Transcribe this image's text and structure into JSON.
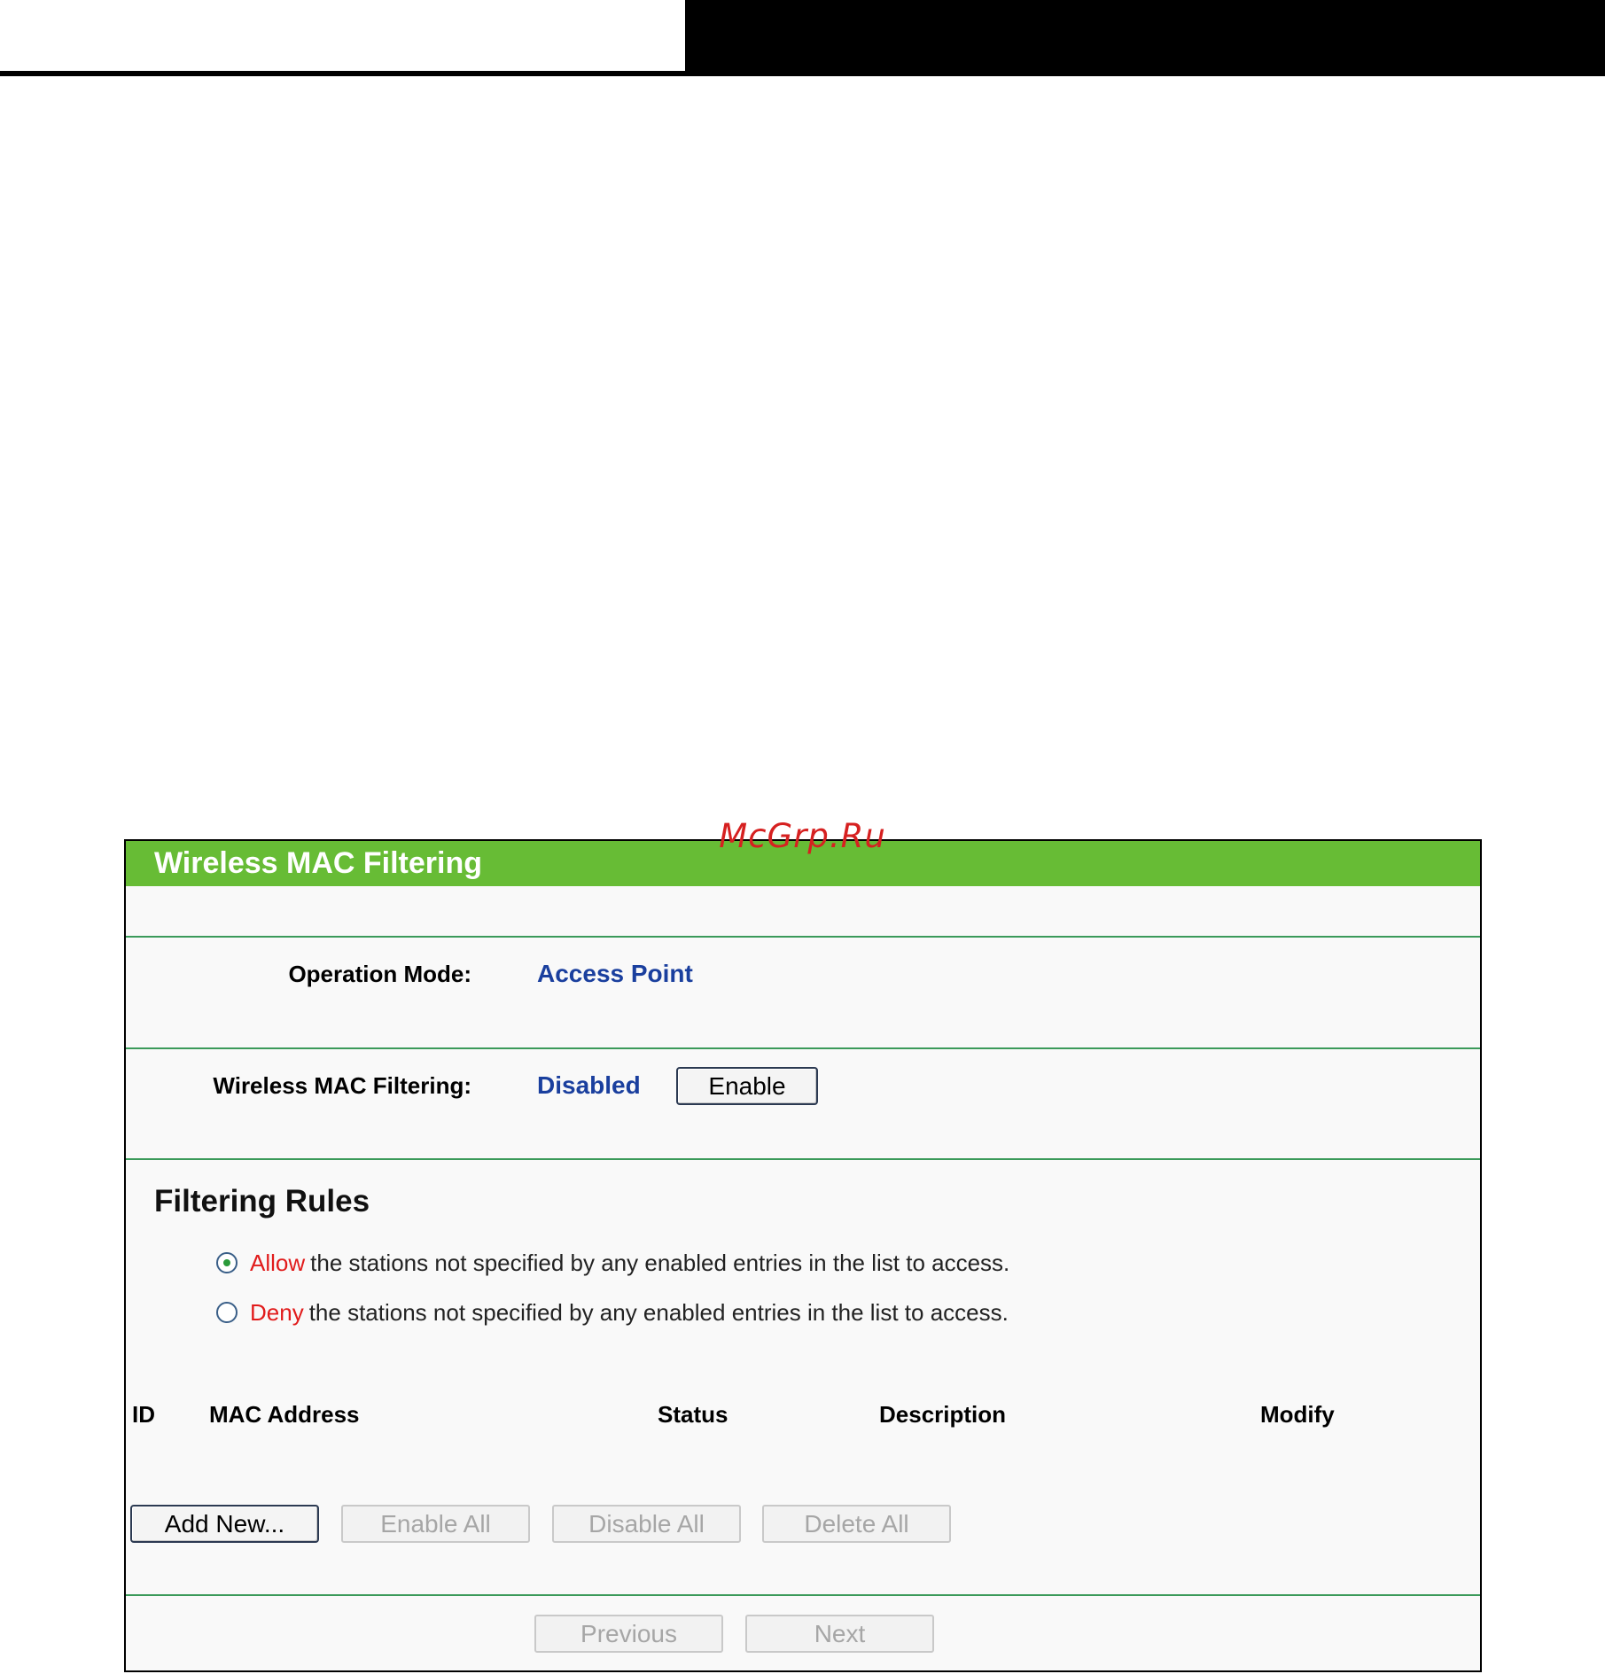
{
  "watermark": "McGrp.Ru",
  "panel": {
    "title": "Wireless MAC Filtering"
  },
  "operation_mode": {
    "label": "Operation Mode:",
    "value": "Access Point"
  },
  "mac_filtering": {
    "label": "Wireless MAC Filtering:",
    "status": "Disabled",
    "enable_button": "Enable"
  },
  "filtering_rules": {
    "heading": "Filtering Rules",
    "options": [
      {
        "keyword": "Allow",
        "text": "the stations not specified by any enabled entries in the list to access.",
        "checked": true
      },
      {
        "keyword": "Deny",
        "text": "the stations not specified by any enabled entries in the list to access.",
        "checked": false
      }
    ]
  },
  "table": {
    "columns": [
      "ID",
      "MAC Address",
      "Status",
      "Description",
      "Modify"
    ]
  },
  "actions": {
    "add_new": "Add New...",
    "enable_all": "Enable All",
    "disable_all": "Disable All",
    "delete_all": "Delete All"
  },
  "pager": {
    "previous": "Previous",
    "next": "Next"
  },
  "colors": {
    "header_green": "#67bc35",
    "value_blue": "#1a3f9e",
    "keyword_red": "#e11b1b",
    "rule_green": "#3b9a5a"
  }
}
